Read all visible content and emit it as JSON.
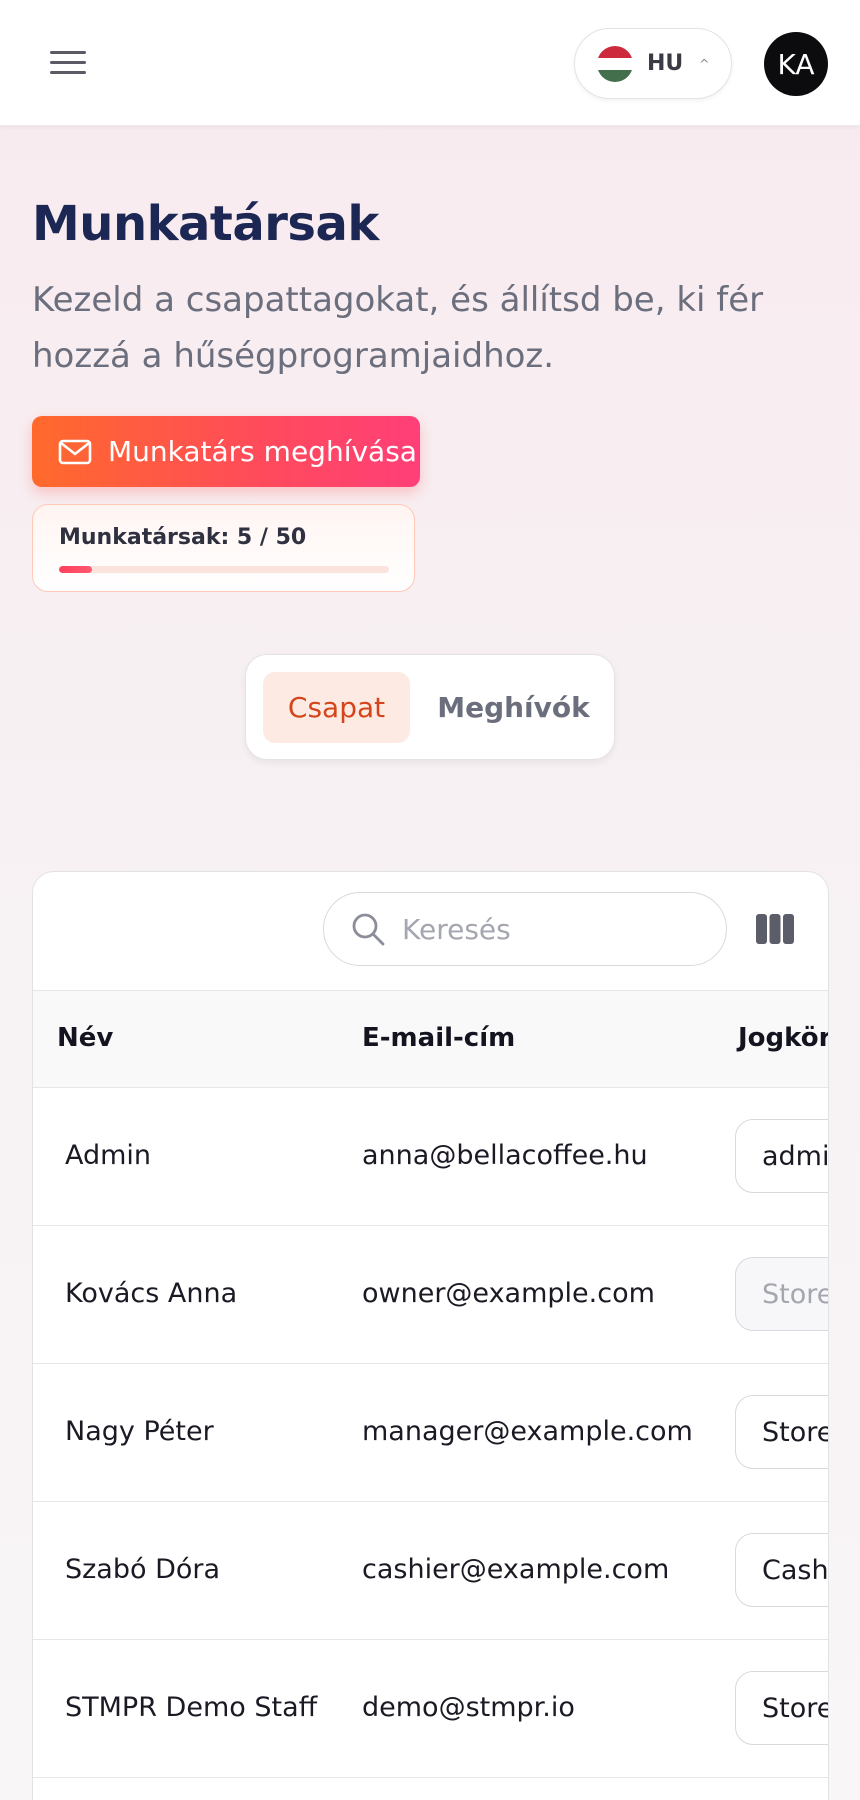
{
  "header": {
    "language": {
      "code": "HU",
      "flag_colors": [
        "#cd2a3e",
        "#ffffff",
        "#436f4d"
      ]
    },
    "avatar_initials": "KA"
  },
  "page": {
    "title": "Munkatársak",
    "subtitle": "Kezeld a csapattagokat, és állítsd be, ki fér hozzá a hűségprogramjaidhoz.",
    "invite_button": "Munkatárs meghívása",
    "limit": {
      "label": "Munkatársak: 5 / 50",
      "used": 5,
      "max": 50,
      "fraction": 0.1
    }
  },
  "tabs": [
    {
      "label": "Csapat",
      "active": true
    },
    {
      "label": "Meghívók",
      "active": false
    }
  ],
  "table": {
    "search_placeholder": "Keresés",
    "columns": [
      "Név",
      "E-mail-cím",
      "Jogkör"
    ],
    "rows": [
      {
        "name": "Admin",
        "email": "anna@bellacoffee.hu",
        "role": "admin",
        "role_disabled": false
      },
      {
        "name": "Kovács Anna",
        "email": "owner@example.com",
        "role": "Store",
        "role_disabled": true
      },
      {
        "name": "Nagy Péter",
        "email": "manager@example.com",
        "role": "Store",
        "role_disabled": false
      },
      {
        "name": "Szabó Dóra",
        "email": "cashier@example.com",
        "role": "Cash",
        "role_disabled": false
      },
      {
        "name": "STMPR Demo Staff",
        "email": "demo@stmpr.io",
        "role": "Store",
        "role_disabled": false
      }
    ]
  },
  "colors": {
    "accent": "#d5451b",
    "title": "#1c2754",
    "button_gradient": [
      "#ff6a2b",
      "#ff3f78"
    ]
  }
}
